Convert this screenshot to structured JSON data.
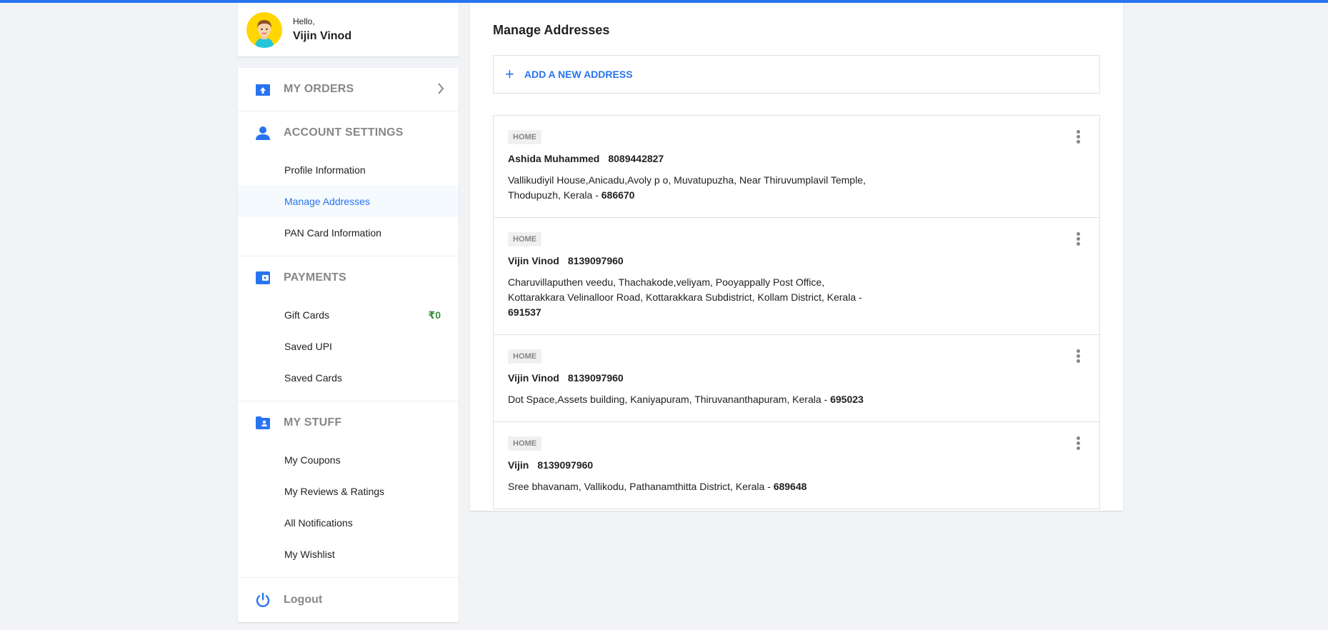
{
  "user": {
    "greeting": "Hello,",
    "name": "Vijin Vinod"
  },
  "sidebar": {
    "my_orders": "MY ORDERS",
    "account_settings": {
      "title": "ACCOUNT SETTINGS",
      "items": [
        "Profile Information",
        "Manage Addresses",
        "PAN Card Information"
      ]
    },
    "payments": {
      "title": "PAYMENTS",
      "gift_cards": "Gift Cards",
      "gift_amount": "₹0",
      "saved_upi": "Saved UPI",
      "saved_cards": "Saved Cards"
    },
    "my_stuff": {
      "title": "MY STUFF",
      "items": [
        "My Coupons",
        "My Reviews & Ratings",
        "All Notifications",
        "My Wishlist"
      ]
    },
    "logout": "Logout"
  },
  "main": {
    "title": "Manage Addresses",
    "add_label": "ADD A NEW ADDRESS",
    "addresses": [
      {
        "tag": "HOME",
        "name": "Ashida Muhammed",
        "phone": "8089442827",
        "address": "Vallikudiyil House,Anicadu,Avoly p o, Muvatupuzha, Near Thiruvumplavil Temple, Thodupuzh, Kerala - ",
        "pincode": "686670"
      },
      {
        "tag": "HOME",
        "name": "Vijin Vinod",
        "phone": "8139097960",
        "address": "Charuvillaputhen veedu, Thachakode,veliyam, Pooyappally Post Office, Kottarakkara Velinalloor Road, Kottarakkara Subdistrict, Kollam District, Kerala - ",
        "pincode": "691537"
      },
      {
        "tag": "HOME",
        "name": "Vijin Vinod",
        "phone": "8139097960",
        "address": "Dot Space,Assets building, Kaniyapuram, Thiruvananthapuram, Kerala - ",
        "pincode": "695023"
      },
      {
        "tag": "HOME",
        "name": "Vijin",
        "phone": "8139097960",
        "address": "Sree bhavanam, Vallikodu, Pathanamthitta District, Kerala - ",
        "pincode": "689648"
      }
    ]
  },
  "colors": {
    "accent": "#2874f0",
    "muted": "#878787",
    "green": "#388e3c",
    "avatar_bg": "#ffd600"
  }
}
